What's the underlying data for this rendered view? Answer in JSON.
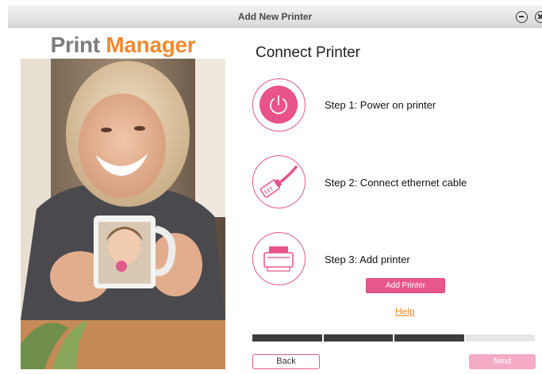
{
  "window": {
    "title": "Add New Printer"
  },
  "brand": {
    "part1": "Print",
    "part2": "Manager",
    "color1": "#7d7d7d",
    "color2": "#f08a30"
  },
  "main": {
    "heading": "Connect Printer"
  },
  "steps": [
    {
      "label": "Step 1: Power on printer",
      "icon": "power-icon"
    },
    {
      "label": "Step 2: Connect ethernet cable",
      "icon": "ethernet-cable-icon"
    },
    {
      "label": "Step 3: Add printer",
      "icon": "printer-icon"
    }
  ],
  "actions": {
    "add_printer": "Add Printer",
    "help": "Help"
  },
  "progress": {
    "total_segments": 4,
    "completed_segments": 3
  },
  "footer": {
    "back": "Back",
    "next": "Next"
  },
  "colors": {
    "accent": "#e8578c",
    "link": "#f08a30",
    "progress_done": "#3d3d3d",
    "progress_todo": "#e6e6e6",
    "disabled": "#f4aac4"
  }
}
